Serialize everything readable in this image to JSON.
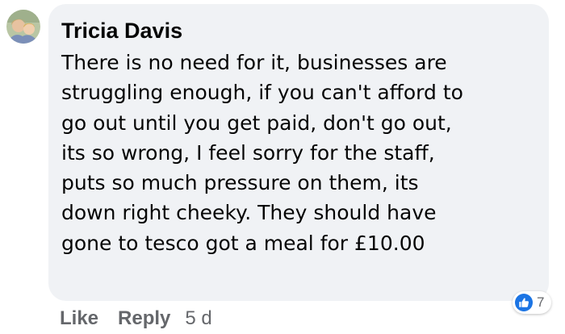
{
  "comment": {
    "author": "Tricia Davis",
    "text_lines": [
      "There is no need for it, businesses are",
      "struggling enough, if you can't afford to",
      "go out until you get paid, don't go out,",
      "its so wrong, I feel sorry for the staff,",
      "puts so much pressure on them, its",
      "down right cheeky. They should have",
      "gone to tesco got a meal for £10.00"
    ],
    "reaction_icon": "like-thumb-icon",
    "reaction_count": "7",
    "actions": {
      "like_label": "Like",
      "reply_label": "Reply",
      "timestamp": "5 d"
    }
  },
  "colors": {
    "bubble_background": "#f0f2f5",
    "text": "#050505",
    "secondary_text": "#65676b",
    "like_blue": "#1b74e4"
  }
}
